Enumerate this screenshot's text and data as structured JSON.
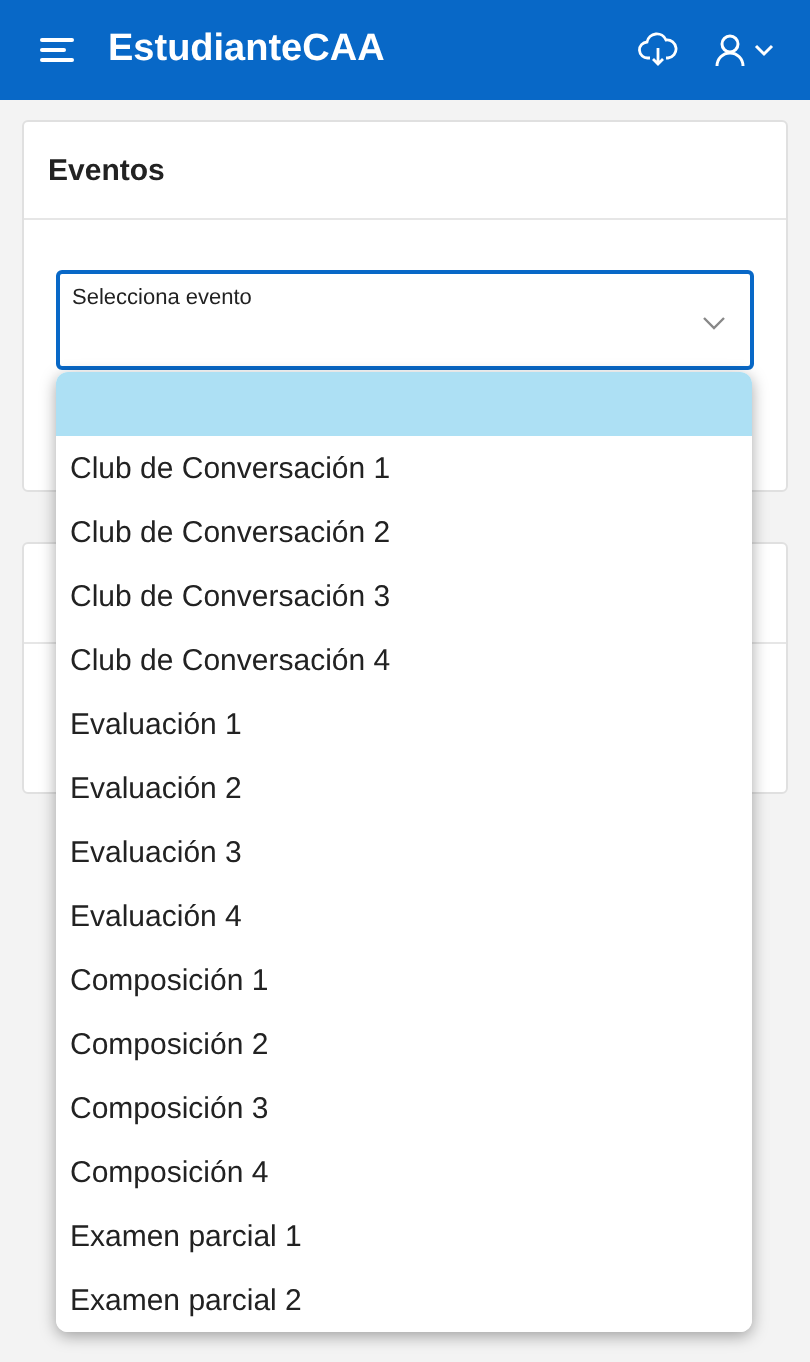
{
  "header": {
    "title": "EstudianteCAA"
  },
  "events_card": {
    "title": "Eventos",
    "select": {
      "label": "Selecciona evento",
      "expanded": true
    }
  },
  "dropdown": {
    "options": [
      {
        "selected": true
      },
      {
        "label": "Club de Conversación 1",
        "selected": false
      },
      {
        "label": "Club de Conversación 2",
        "selected": false
      },
      {
        "label": "Club de Conversación 3",
        "selected": false
      },
      {
        "label": "Club de Conversación 4",
        "selected": false
      },
      {
        "label": "Evaluación 1",
        "selected": false
      },
      {
        "label": "Evaluación 2",
        "selected": false
      },
      {
        "label": "Evaluación 3",
        "selected": false
      },
      {
        "label": "Evaluación 4",
        "selected": false
      },
      {
        "label": "Composición 1",
        "selected": false
      },
      {
        "label": "Composición 2",
        "selected": false
      },
      {
        "label": "Composición 3",
        "selected": false
      },
      {
        "label": "Composición 4",
        "selected": false
      },
      {
        "label": "Examen parcial 1",
        "selected": false
      },
      {
        "label": "Examen parcial 2",
        "selected": false
      }
    ]
  }
}
